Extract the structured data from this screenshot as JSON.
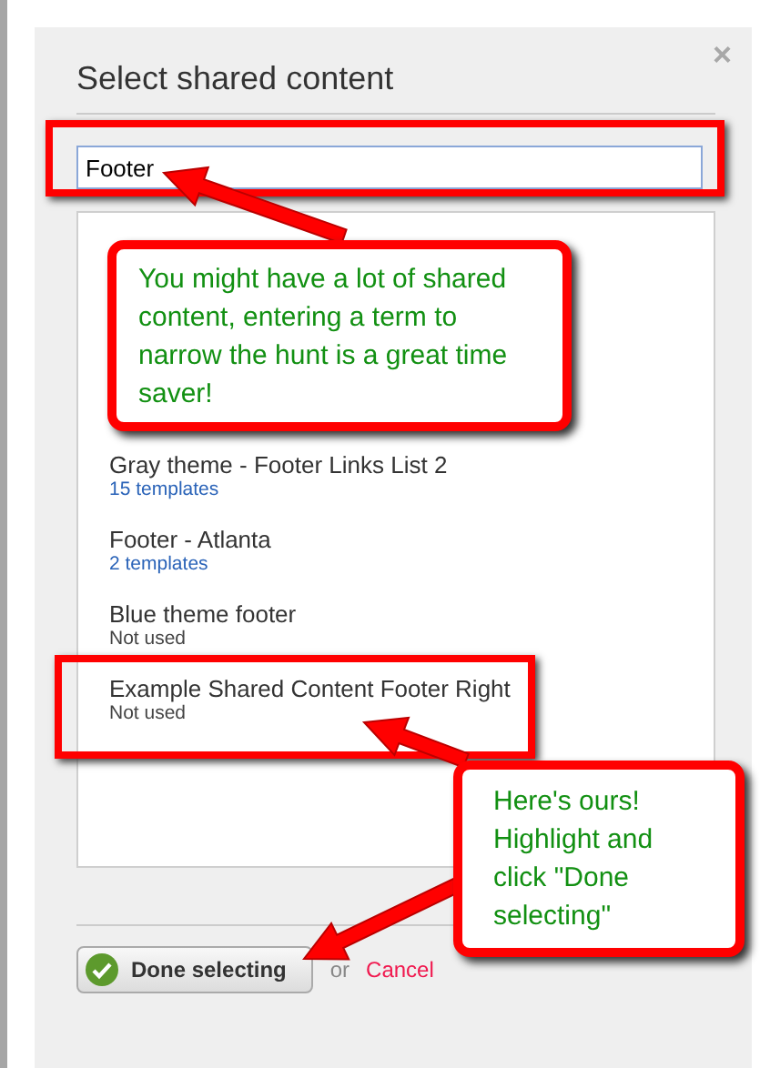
{
  "dialog": {
    "title": "Select shared content",
    "close": "×"
  },
  "search": {
    "value": "Footer",
    "highlighted": true
  },
  "items": [
    {
      "name": "Gray theme - Footer Links List 2",
      "usage": "15 templates",
      "kind": "link",
      "highlighted": false
    },
    {
      "name": "Footer - Atlanta",
      "usage": "2 templates",
      "kind": "link",
      "highlighted": false
    },
    {
      "name": "Blue theme footer",
      "usage": "Not used",
      "kind": "plain",
      "highlighted": false
    },
    {
      "name": "Example Shared Content Footer Right",
      "usage": "Not used",
      "kind": "plain",
      "highlighted": true
    }
  ],
  "footer": {
    "done": "Done selecting",
    "or": "or",
    "cancel": "Cancel"
  },
  "annotations": [
    {
      "text": "You might have a lot of shared content, entering a term to narrow the hunt is a great time saver!"
    },
    {
      "text": "Here's ours! Highlight and click \"Done selecting\""
    }
  ]
}
